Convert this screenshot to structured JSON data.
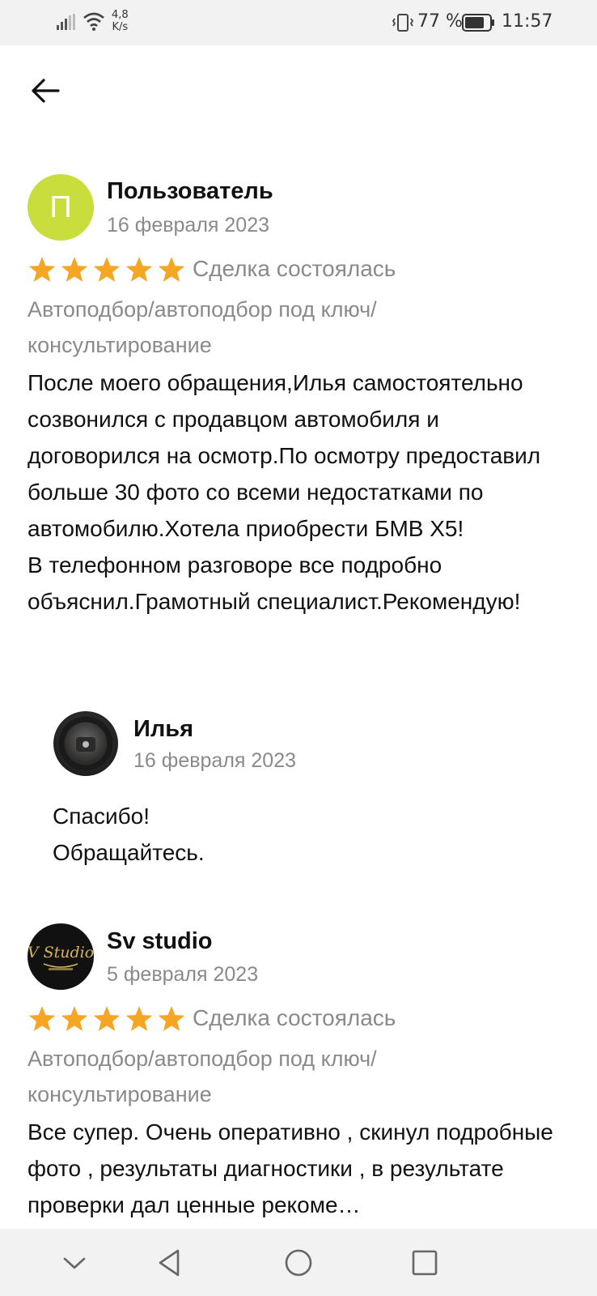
{
  "status_bar": {
    "network_speed_value": "4,8",
    "network_speed_unit": "K/s",
    "battery_percent": "77 %",
    "time": "11:57",
    "icons": [
      "signal-icon",
      "wifi-icon",
      "vibrate-icon",
      "battery-icon"
    ]
  },
  "header": {
    "back_icon": "arrow-left-icon"
  },
  "reviews": [
    {
      "avatar_letter": "П",
      "avatar_color": "#c9dd3c",
      "author": "Пользователь",
      "date": "16 февраля 2023",
      "rating": 5,
      "deal_status": "Сделка состоялась",
      "category": "Автоподбор/автоподбор под ключ/ консультирование",
      "text": "После  моего обращения,Илья самостоятельно созвонился с продавцом автомобиля и договорился на осмотр.По осмотру предоставил больше 30 фото со всеми недостатками по автомобилю.Хотела приобрести БМВ Х5!\nВ телефонном разговоре все подробно объяснил.Грамотный специалист.Рекомендую!",
      "reply": {
        "author": "Илья",
        "date": "16 февраля 2023",
        "text": "Спасибо!\nОбращайтесь."
      }
    },
    {
      "avatar_logo_text": "V Studio",
      "author": "Sv studio",
      "date": "5 февраля 2023",
      "rating": 5,
      "deal_status": "Сделка состоялась",
      "category": "Автоподбор/автоподбор под ключ/ консультирование",
      "text": "Все супер. Очень оперативно , скинул подробные фото , результаты диагностики , в результате проверки дал ценные рекоме…"
    }
  ],
  "colors": {
    "star": "#f5a623",
    "muted_text": "#8a8a8a",
    "system_bar": "#f2f2f2"
  },
  "nav_bar": {
    "icons": [
      "chevron-down-icon",
      "back-triangle-icon",
      "home-circle-icon",
      "recents-square-icon"
    ]
  }
}
